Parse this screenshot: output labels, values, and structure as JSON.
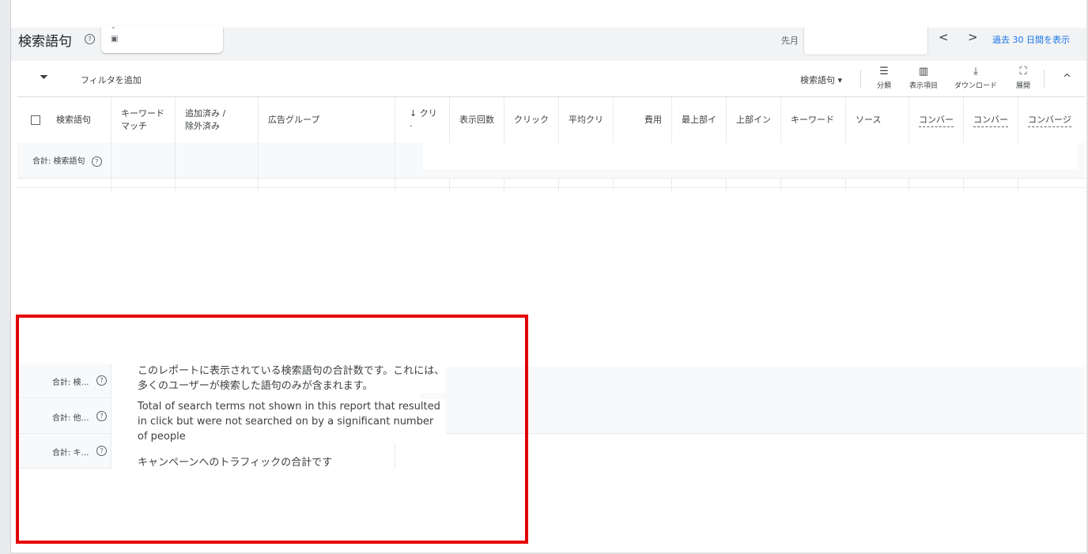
{
  "header": {
    "title": "検索語句",
    "help": "?",
    "date_label": "先月",
    "last30_link": "過去 30 日間を表示",
    "nav_prev": "<",
    "nav_next": ">"
  },
  "toolbar": {
    "filter_add": "フィルタを追加",
    "segment_dropdown": "検索語句 ▾",
    "segment": "分類",
    "columns": "表示項目",
    "download": "ダウンロード",
    "expand": "展開",
    "collapse": "^"
  },
  "table": {
    "headers": [
      {
        "label": "検索語句"
      },
      {
        "label": "キーワード\nマッチ"
      },
      {
        "label": "追加済み /\n除外済み"
      },
      {
        "label": "広告グループ"
      },
      {
        "label": "↓ クリ·"
      },
      {
        "label": "表示回数"
      },
      {
        "label": "クリック"
      },
      {
        "label": "平均クリ"
      },
      {
        "label": "費用"
      },
      {
        "label": "最上部イ"
      },
      {
        "label": "上部イン"
      },
      {
        "label": "キーワード"
      },
      {
        "label": "ソース"
      },
      {
        "label": "コンバー"
      },
      {
        "label": "コンバー"
      },
      {
        "label": "コンバージ"
      }
    ],
    "total_row_label": "合計: 検索語句",
    "lower_rows": [
      {
        "label": "合計: 検…"
      },
      {
        "label": "合計: 他…"
      },
      {
        "label": "合計: キ…"
      }
    ]
  },
  "tooltips": {
    "tooltip1": "このレポートに表示されている検索語句の合計数です。これには、多くのユーザーが検索した語句のみが含まれます。",
    "tooltip2": "Total of search terms not shown in this report that resulted in click but were not searched on by a significant number of people",
    "tooltip3": "キャンペーンへのトラフィックの合計です"
  },
  "colors": {
    "accent": "#1a73e8",
    "highlight": "#e50000"
  }
}
